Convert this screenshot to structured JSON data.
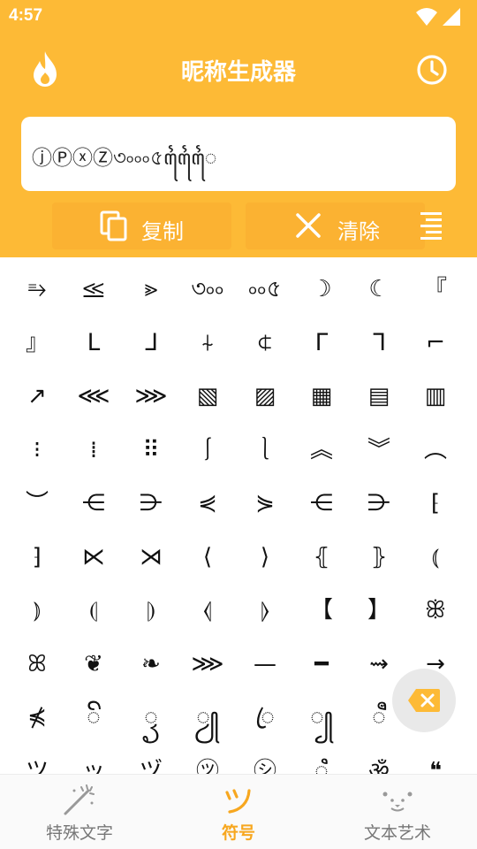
{
  "status_bar": {
    "time": "4:57"
  },
  "app": {
    "title": "昵称生成器"
  },
  "input": {
    "value": "ⓙⓅⓧⓏ৩৹৹৹৫ꦻꦻꦻ"
  },
  "actions": {
    "copy_label": "复制",
    "clear_label": "清除"
  },
  "symbols": [
    "⥱",
    "⪣",
    "⪢",
    "৩৹৹",
    "৹৹৫",
    "☽",
    "☾",
    "『",
    "』",
    "ᒪ",
    "ᒧ",
    "⍭",
    "⍧",
    "ᒥ",
    "ᒣ",
    "⌐",
    "↗",
    "⋘",
    "⋙",
    "▧",
    "▨",
    "▦",
    "▤",
    "▥",
    "⁝",
    "⁞",
    "⠿",
    "⎰",
    "⎱",
    "︽",
    "︾",
    "︵",
    "︶",
    "⋲",
    "⋺",
    "⋞",
    "⋟",
    "⋲",
    "⋺",
    "⁅",
    "⁆",
    "⋉",
    "⋊",
    "⟨",
    "⟩",
    "⦃",
    "⦄",
    "⦅",
    "⦆",
    "⦇",
    "⦈",
    "⦉",
    "⦊",
    "【",
    "】",
    "ꕥ",
    "ꕤ",
    "❦",
    "❧",
    "⋙",
    "—",
    "━",
    "⇝",
    "→",
    "⋠",
    "ꦼ",
    "ꦽ",
    "ꦾ",
    "ꦿ",
    "꧀",
    "ꦷ",
    "",
    "ツ",
    "ッ",
    "ヅ",
    "㋡",
    "㋛",
    "ꦶ",
    "ॐ",
    "❝"
  ],
  "bottom_nav": [
    {
      "label": "特殊文字",
      "icon": "magic-wand-icon",
      "active": false
    },
    {
      "label": "符号",
      "icon": "tsu-symbol-icon",
      "active": true
    },
    {
      "label": "文本艺术",
      "icon": "kaomoji-face-icon",
      "active": false
    }
  ],
  "colors": {
    "primary": "#FDBA36",
    "button": "#FBB232",
    "active_tab": "#F7A71F",
    "backspace": "#FDBA36"
  }
}
